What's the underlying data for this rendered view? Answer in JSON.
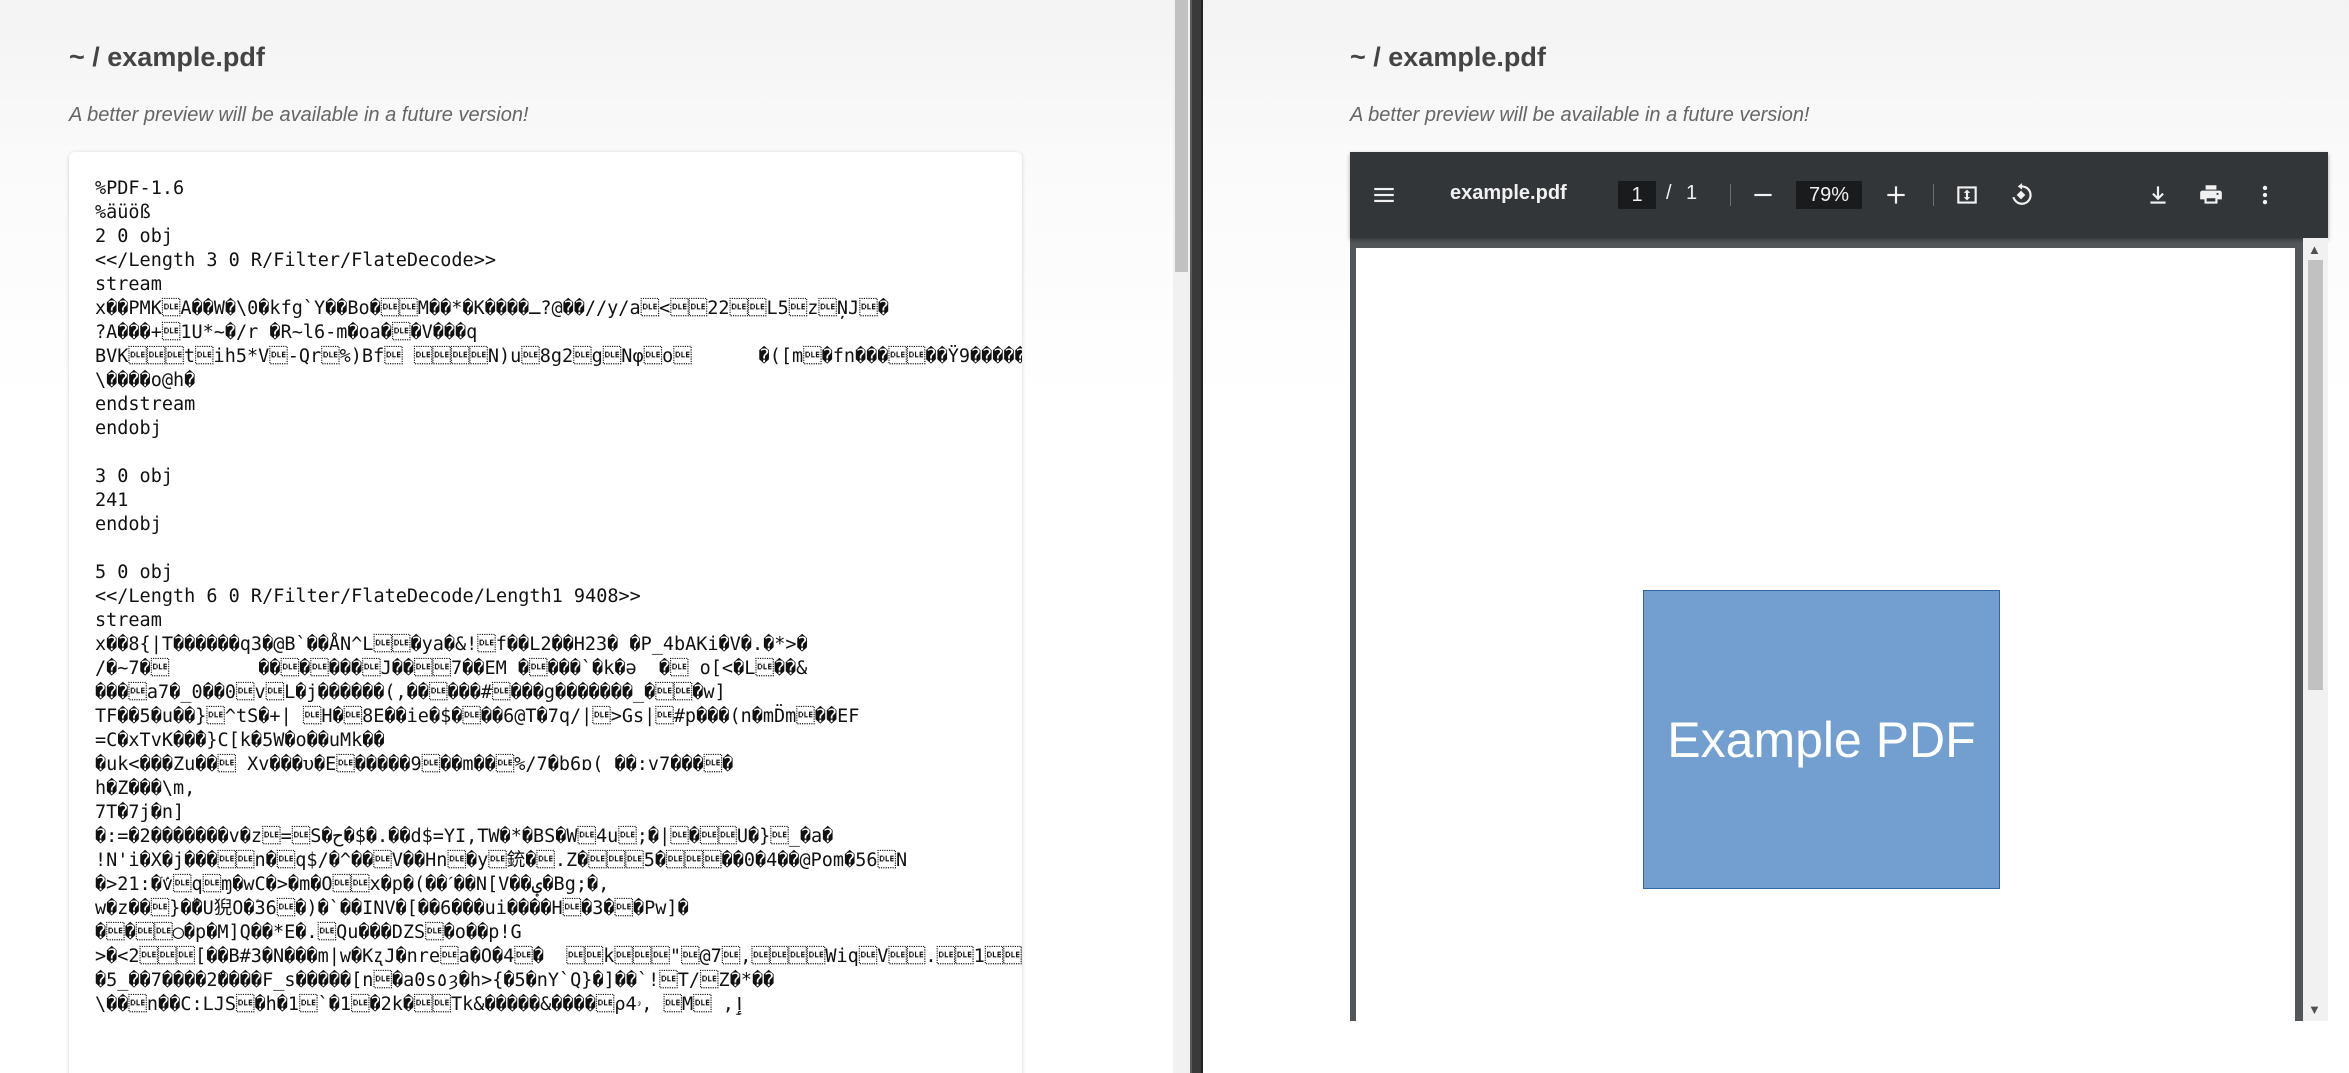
{
  "left_pane": {
    "title": "~ / example.pdf",
    "notice": "A better preview will be available in a future version!",
    "raw_lines": [
      "%PDF-1.6",
      "%äüöß",
      "2 0 obj",
      "<</Length 3 0 R/Filter/FlateDecode>>",
      "stream",
      "x��PMK\u0010A��W�\\0�kfg`Y��Bo�\u0010\u0010M��*�K����ـ?@��//y/a\u0010<\u0010\u001022\u0010\u0010L5\u0010z\u0010ŅJ\u0010�",
      "?A���+\u00101U*~�/r �R~l6-m�oa�\u0010�V���q",
      "BVK\u0010\u0010\u0010t\u0010ih5*V\u0010-Qr\u0010%)Bf\u0010 \u0010\u0010\u0010\u0010N)u\u00108g2\u0010g\u0010Nφ\u0010o\u0010      �([m\u0010�fn���\u0010\u0010��Ÿ9�����",
      "\\����o@h�",
      "endstream",
      "endobj",
      "",
      "3 0 obj",
      "241",
      "endobj",
      "",
      "5 0 obj",
      "<</Length 6 0 R/Filter/FlateDecode/Length1 9408>>",
      "stream",
      "x��8{|T������q3�@B`��ÅN^L\u0010\u0010�ya�&!\u0010f��L2��H23� �P_4bAKi�V�.�*>�",
      "/�~7�\u0010        ��\u0010�\u0010���\u0010J��\u0010\u00107��EM �\u0010���`�k�ə  �\u0010 o[<�L\u0010��&",
      "���\u0010a7�_0��0\u0010v\u0010L�j������(,��\u0010���#\u0010���g�������_�\u0010\u0010�w]",
      "ΤF��5�u��}\u0010^tS�+| \u0010H�\u00108E��ie�$�\u0010��6@T�7q/|\u0010>Gs|\u0010#p���(n�mD̈m\u0010��EF",
      "=C�xTvK��̄�}C[k�5W�o��uMk��",
      "�uk<���Zu��\u0010 Xv���υ�E\u0010�����9\u0010��m��\u0010%/7�b6ɒ( ��:v7���\u0010�",
      "h�Z���\\m,",
      "7T�7j�n]",
      "�:=�2�������v�z\u0010=\u0010S�ح�$�.��d$=YI,TW�*�BS�W\u00104u\u0010;�|\u0010�\u0010\u0010U�}\u0010_�a�",
      "!N'i�X�j���\u0010\u0010n�\u0010q$/�^��\u0010V��Hn\u0010�y\u0010銃�\u0010.Z�\u0010\u0010\u00105�\u0010\u0010\u0010��0�4��@Pom�56\u0010N",
      "�>21:�ׁۢv\u0010q\u0010ɱ�wC�>�m�O\u0010\u0010x�p�(��ˊ��N[V��ؠ�Bg;�,",
      "w�z��\u0010}�ۖ�U猊O�ؘ36\u0010�)�`��INV�[��6���ui����H\u0010�3�\u0010�Pw]�",
      "�\u0010�\u0010\u0010◯�p�M]Q��*E�.\u0010Qu���DZS\u0010�o��p!G",
      ">�<2\u0010\u0010\u0010[��B#3�N���m|w�KʐJ�nre\u0010a�O�4\u0010�  \u0010\u0010k\u0010\u0010\u0010\"\u0010@7\u0010,\u0010\u0010\u0010\u0010Wiq\u0010V\u0010\u0010.\u0010\u00101\u0010\u0010\u0010*",
      "�5_��7����2̂����F_s�����[n\u0010�a0s٥ȝ�h>{�5�nY`Q}�]��`!\u0010T/\u0010Z�*��",
      "\\��\u0010n��C:LJS\u0010�h�1\u0010`�1\u0010�2k�\u0010\u0010Tk&�����&����\u0010ρ4ۥ, \u0010M\u0010 ,ٳ"
    ]
  },
  "right_pane": {
    "title": "~ / example.pdf",
    "notice": "A better preview will be available in a future version!"
  },
  "pdf_viewer": {
    "toolbar": {
      "menu_icon": "hamburger-menu-icon",
      "filename": "example.pdf",
      "current_page": "1",
      "page_separator": "/",
      "total_pages": "1",
      "zoom": "79%",
      "icons": [
        "zoom-out-icon",
        "zoom-in-icon",
        "fit-page-icon",
        "rotate-icon",
        "download-icon",
        "print-icon",
        "more-vert-icon"
      ]
    },
    "page": {
      "box_text": "Example PDF",
      "box_fill": "#729fcf",
      "box_border": "#3465a4"
    },
    "colors": {
      "toolbar_bg": "#323639",
      "viewer_bg": "#525659"
    }
  }
}
